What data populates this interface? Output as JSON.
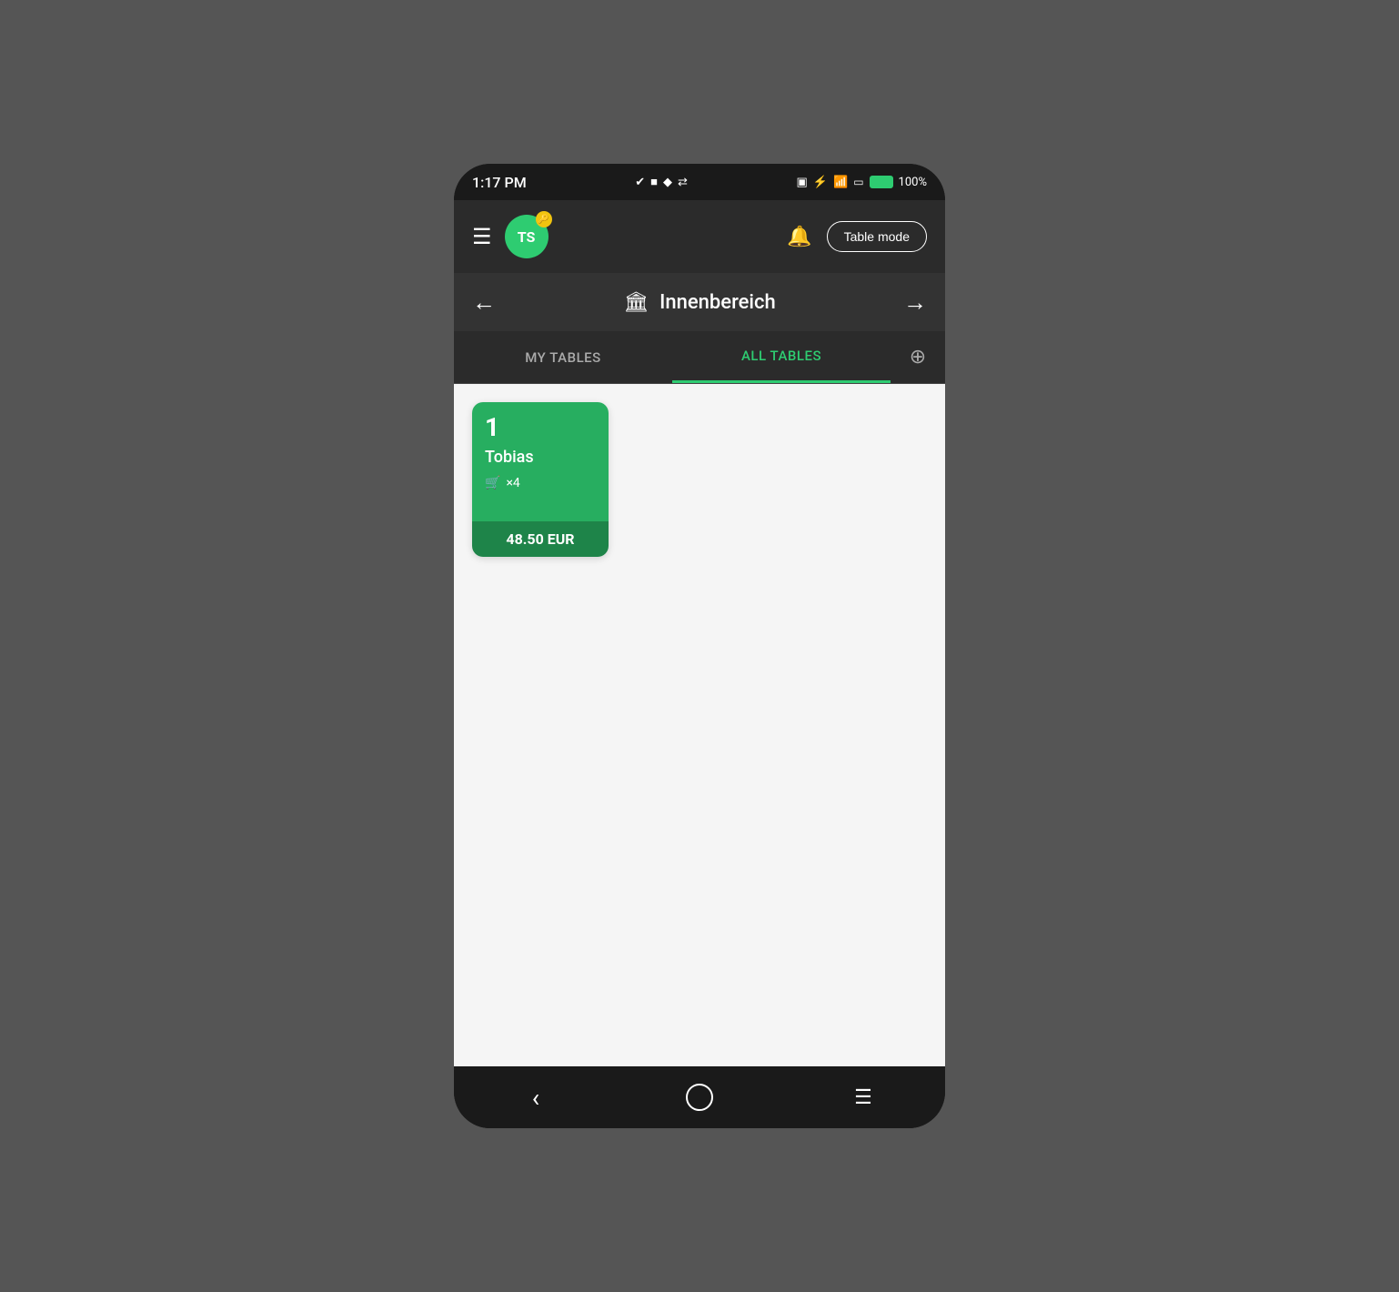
{
  "statusBar": {
    "time": "1:17 PM",
    "batteryPercent": "100%",
    "icons": [
      "check-icon",
      "square-icon",
      "diamond-icon",
      "arrows-icon"
    ]
  },
  "header": {
    "avatarInitials": "TS",
    "avatarBadge": "🔑",
    "tableModeLabel": "Table mode"
  },
  "locationBar": {
    "title": "Innenbereich",
    "iconLabel": "building-icon"
  },
  "tabs": [
    {
      "label": "MY TABLES",
      "active": false
    },
    {
      "label": "ALL TABLES",
      "active": true
    }
  ],
  "tableCard": {
    "number": "1",
    "name": "Tobias",
    "guests": "×4",
    "amount": "48.50 EUR"
  },
  "bottomNav": {
    "back": "‹",
    "home": "○",
    "menu": "≡"
  }
}
